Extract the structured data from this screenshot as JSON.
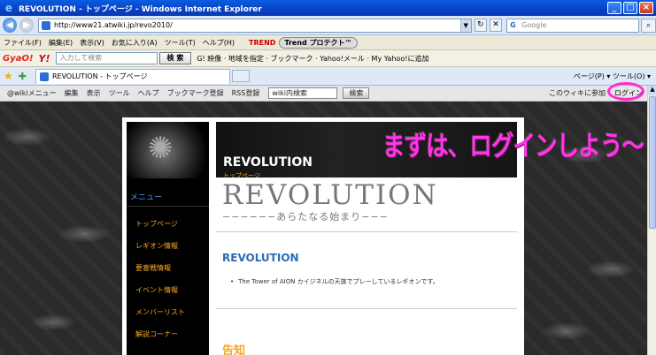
{
  "window": {
    "title": "REVOLUTION - トップページ - Windows Internet Explorer",
    "buttons": [
      "_",
      "□",
      "×"
    ]
  },
  "address_bar": {
    "url": "http://www21.atwiki.jp/revo2010/",
    "search_placeholder": "Google"
  },
  "menu_bar": {
    "items": [
      "ファイル(F)",
      "編集(E)",
      "表示(V)",
      "お気に入り(A)",
      "ツール(T)",
      "ヘルプ(H)"
    ],
    "trend_logo": "TREND",
    "trend_pill": "Trend プロテクト™"
  },
  "yahoo_bar": {
    "gyao": "GyaO!",
    "yahoo": "Y!",
    "search_placeholder": "入力して検索",
    "search_button": "検 索",
    "tools": "G! 映像 · 地域を指定 · ブックマーク · Yahoo!メール · My Yahoo!に追加"
  },
  "tab_bar": {
    "tab_title": "REVOLUTION - トップページ",
    "ie_tools": "ページ(P) ▾ ツール(O) ▾"
  },
  "wiki_bar": {
    "items": [
      "@wikiメニュー",
      "編集",
      "表示",
      "ツール",
      "ヘルプ",
      "ブックマーク登録",
      "RSS登録"
    ],
    "search_value": "wiki内検索",
    "search_button": "検索",
    "join": "このウィキに参加",
    "login": "ログイン"
  },
  "sidebar": {
    "menu_heading": "メニュー",
    "items": [
      "トップページ",
      "レギオン情報",
      "要塞戦情報",
      "イベント情報",
      "メンバーリスト",
      "解説コーナー"
    ]
  },
  "banner": {
    "title": "REVOLUTION",
    "subtitle": "トップページ"
  },
  "overlay_text": "まずは、ログインしよう～",
  "main": {
    "logo_word": "REVOLUTION",
    "logo_sub": "−−−−−−あらたなる始まり−−−",
    "heading": "REVOLUTION",
    "bullet": "The Tower of AION カイジネルの天族でプレーしているレギオンです。",
    "notice_heading": "告知"
  }
}
